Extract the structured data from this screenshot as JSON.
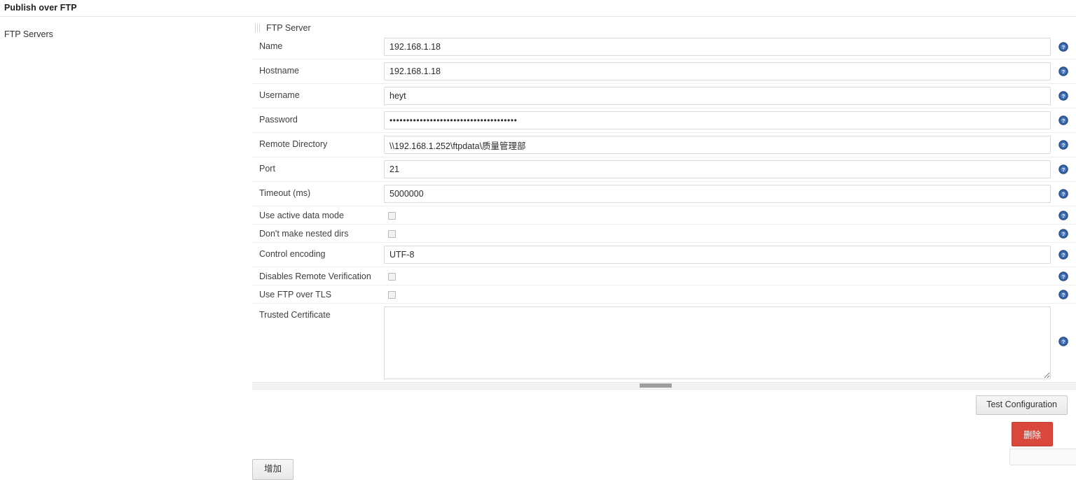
{
  "page": {
    "title": "Publish over FTP"
  },
  "section": {
    "label": "FTP Servers",
    "block_title": "FTP Server",
    "grip_icon": "drag-handle-icon"
  },
  "fields": [
    {
      "label": "Name",
      "type": "text",
      "value": "192.168.1.18"
    },
    {
      "label": "Hostname",
      "type": "text",
      "value": "192.168.1.18"
    },
    {
      "label": "Username",
      "type": "text",
      "value": "heyt"
    },
    {
      "label": "Password",
      "type": "password",
      "value": "••••••••••••••••••••••••••••••••••••••"
    },
    {
      "label": "Remote Directory",
      "type": "text",
      "value": "\\\\192.168.1.252\\ftpdata\\质量管理部"
    },
    {
      "label": "Port",
      "type": "text",
      "value": "21"
    },
    {
      "label": "Timeout (ms)",
      "type": "text",
      "value": "5000000"
    },
    {
      "label": "Use active data mode",
      "type": "checkbox",
      "checked": false
    },
    {
      "label": "Don't make nested dirs",
      "type": "checkbox",
      "checked": false
    },
    {
      "label": "Control encoding",
      "type": "text",
      "value": "UTF-8"
    },
    {
      "label": "Disables Remote Verification",
      "type": "checkbox",
      "checked": false
    },
    {
      "label": "Use FTP over TLS",
      "type": "checkbox",
      "checked": false
    },
    {
      "label": "Trusted Certificate",
      "type": "textarea",
      "value": ""
    }
  ],
  "buttons": {
    "test_configuration": "Test Configuration",
    "delete": "删除",
    "add": "增加"
  },
  "icons": {
    "help": "help-circle-icon"
  },
  "colors": {
    "danger": "#d9483b",
    "help_icon": "#2f5c9e",
    "border": "#dadada",
    "rule": "#efefef"
  }
}
